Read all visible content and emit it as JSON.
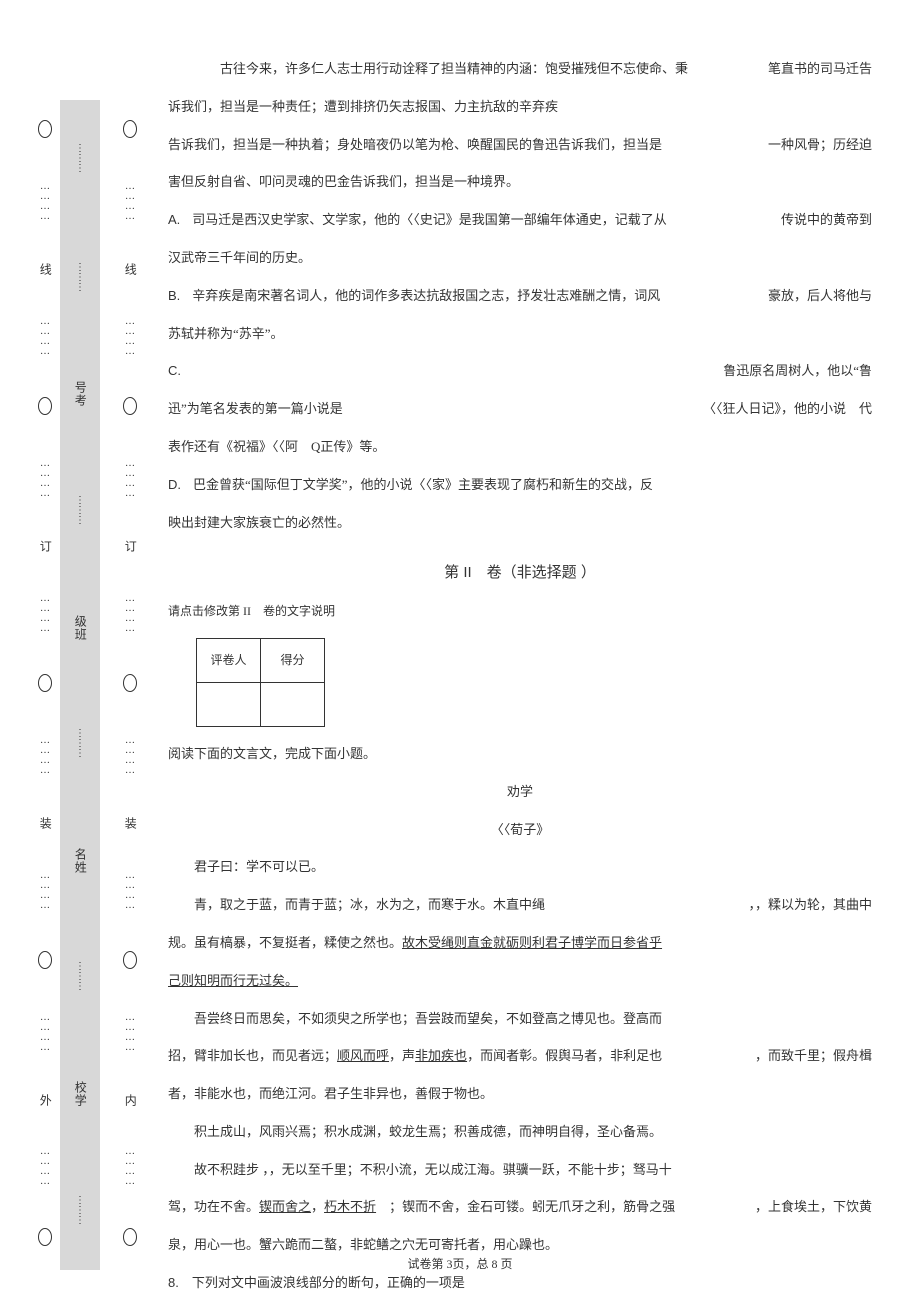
{
  "intro": {
    "p1": "古往今来，许多仁人志士用行动诠释了担当精神的内涵：饱受摧残但不忘使命、秉",
    "p1_suffix": "笔直书的司马迁告",
    "p1_cont1": "诉我们，担当是一种责任；遭到排挤仍矢志报国、力主抗敌的辛弃疾",
    "p1_cont2": "告诉我们，担当是一种执着；身处暗夜仍以笔为枪、唤醒国民的鲁迅告诉我们，担当是",
    "p1_cont2_suffix": "一种风骨；历经迫",
    "p1_cont3": "害但反射自省、叩问灵魂的巴金告诉我们，担当是一种境界。"
  },
  "options": {
    "A": {
      "label": "A.",
      "pre": "司马迁是西汉史学家、文学家，他的〈〈史记》是我国第一部编年体通史，记载了从",
      "suf": "传说中的黄帝到",
      "cont": "汉武帝三千年间的历史。"
    },
    "B": {
      "label": "B.",
      "pre": "辛弃疾是南宋著名词人，他的词作多表达抗敌报国之志，抒发壮志难酬之情，词风",
      "suf": "豪放，后人将他与",
      "cont": "苏轼并称为“苏辛”。"
    },
    "C": {
      "label": "C.",
      "suf": "鲁迅原名周树人，他以“鲁",
      "line2_pre": "迅”为笔名发表的第一篇小说是",
      "line2_suf": "〈〈狂人日记》，他的小说",
      "line2_end": "代",
      "cont": "表作还有《祝福》〈〈阿　Q正传》等。"
    },
    "D": {
      "label": "D.",
      "pre": "巴金曾获“国际但丁文学奖”，他的小说〈〈家》主要表现了腐朽和新生的交战，反",
      "cont": "映出封建大家族衰亡的必然性。"
    }
  },
  "section2": {
    "title": "第 II　卷（非选择题 ）",
    "note": "请点击修改第 II　卷的文字说明",
    "grader_col1": "评卷人",
    "grader_col2": "得分",
    "lead": "阅读下面的文言文，完成下面小题。",
    "article_title": "劝学",
    "article_author": "〈〈荀子》",
    "t1": "君子曰：学不可以已。",
    "t2_pre": "青，取之于蓝，而青于蓝；冰，水为之，而寒于水。木直中绳",
    "t2_suf": "，，糅以为轮，其曲中",
    "t3": "规。虽有槁暴，不复挺者，糅使之然也。",
    "t3_ul": "故木受绳则直金就砺则利君子博学而日参省乎",
    "t4_ul": "己则知明而行无过矣。",
    "t5": "吾尝终日而思矣，不如须臾之所学也；吾尝跂而望矣，不如登高之博见也。登高而",
    "t6_pre": "招，臂非加长也，而见者远；",
    "t6_ul": "顺风而呼",
    "t6_mid1": "，声",
    "t6_ul2": "非加疾也",
    "t6_mid2": "，而闻者彰。假舆马者，非利足也",
    "t6_suf": "，而致千里；假舟楫",
    "t7": "者，非能水也，而绝江河。君子生非异也，善假于物也。",
    "t8": "积土成山，风雨兴焉；积水成渊，蛟龙生焉；积善成德，而神明自得，圣心备焉。",
    "t9": "故不积跬步 ，，无以至千里；不积小流，无以成江海。骐骥一跃，不能十步；驽马十",
    "t10_pre": "驾，功在不舍。",
    "t10_ul1": "锲而舍之",
    "t10_mid1": "，",
    "t10_ul2": "朽木不折",
    "t10_mid2": "　；锲而不舍，金石可镂。蚓无爪牙之利，筋骨之强",
    "t10_suf": "，上食埃土，下饮黄",
    "t11": "泉，用心一也。蟹六跪而二螯，非蛇鳝之穴无可寄托者，用心躁也。"
  },
  "q8": {
    "num": "8.",
    "text": "下列对文中画波浪线部分的断句，正确的一项是"
  },
  "footer": "试卷第 3页，总 8 页",
  "margin": {
    "wai": "外",
    "zhuang": "装",
    "ding": "订",
    "xian": "线",
    "nei": "内",
    "xuexiao": "校学",
    "xingming": "名姓",
    "banji": "级班",
    "kaohao": "号考"
  }
}
